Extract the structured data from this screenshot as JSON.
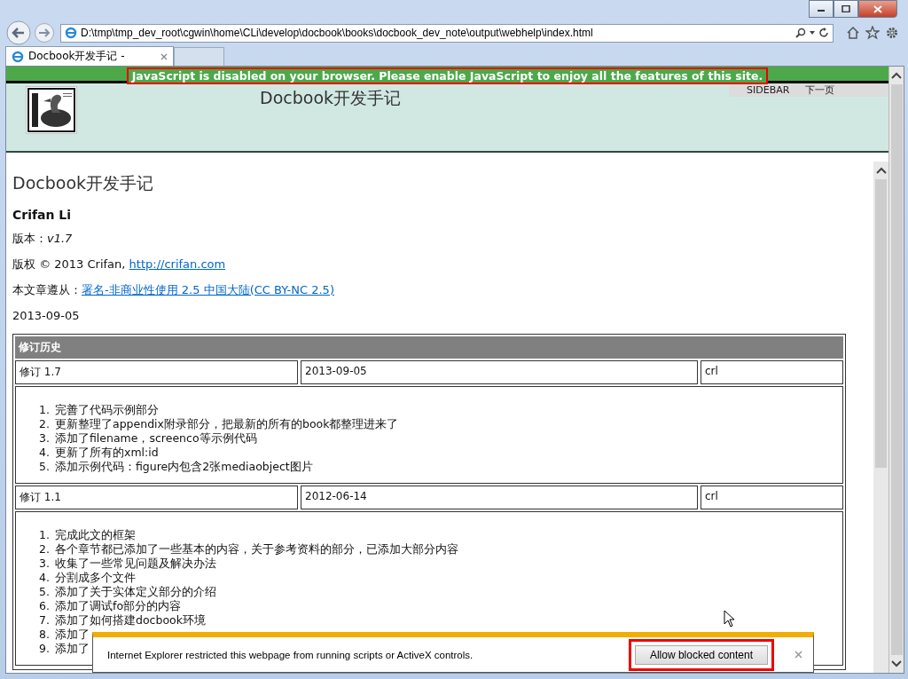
{
  "address_bar": {
    "url": "D:\\tmp\\tmp_dev_root\\cgwin\\home\\CLi\\develop\\docbook\\books\\docbook_dev_note\\output\\webhelp\\index.html"
  },
  "tabs": [
    {
      "title": "Docbook开发手记 -",
      "selected": true
    }
  ],
  "banner": {
    "text": "JavaScript is disabled on your browser. Please enable JavaScript to enjoy all the features of this site."
  },
  "header": {
    "title": "Docbook开发手记",
    "nav": [
      "SIDEBAR",
      "下一页"
    ]
  },
  "content": {
    "title": "Docbook开发手记",
    "author": "Crifan Li",
    "version": "版本：*v1.7*",
    "copyright": "版权 © 2013 Crifan, ",
    "copyright_link": "http://crifan.com",
    "license": "本文章遵从：",
    "license_link": "署名-非商业性使用 2.5 中国大陆(CC BY-NC 2.5)",
    "date": "2013-09-05"
  },
  "revision_table": {
    "heading": "修订历史",
    "revisions": [
      {
        "revision": "修订 1.7",
        "date": "2013-09-05",
        "author": "crl",
        "items": [
          {
            "number": "1.",
            "text": "完善了代码示例部分"
          },
          {
            "number": "2.",
            "text": "更新整理了appendix附录部分，把最新的所有的book都整理进来了"
          },
          {
            "number": "3.",
            "text": "添加了filename，screenco等示例代码"
          },
          {
            "number": "4.",
            "text": "更新了所有的xml:id"
          },
          {
            "number": "5.",
            "text": "添加示例代码：figure内包含2张mediaobject图片"
          }
        ]
      },
      {
        "revision": "修订 1.1",
        "date": "2012-06-14",
        "author": "crl",
        "items": [
          {
            "number": "1.",
            "text": "完成此文的框架"
          },
          {
            "number": "2.",
            "text": "各个章节都已添加了一些基本的内容，关于参考资料的部分，已添加大部分内容"
          },
          {
            "number": "3.",
            "text": "收集了一些常见问题及解决办法"
          },
          {
            "number": "4.",
            "text": "分割成多个文件"
          },
          {
            "number": "5.",
            "text": "添加了关于实体定义部分的介绍"
          },
          {
            "number": "6.",
            "text": "添加了调试fo部分的内容"
          },
          {
            "number": "7.",
            "text": "添加了如何搭建docbook环境"
          },
          {
            "number": "8.",
            "text": "添加了"
          },
          {
            "number": "9.",
            "text": "添加了"
          }
        ]
      }
    ]
  },
  "notification": {
    "message": "Internet Explorer restricted this webpage from running scripts or ActiveX controls.",
    "button": "Allow blocked content"
  }
}
